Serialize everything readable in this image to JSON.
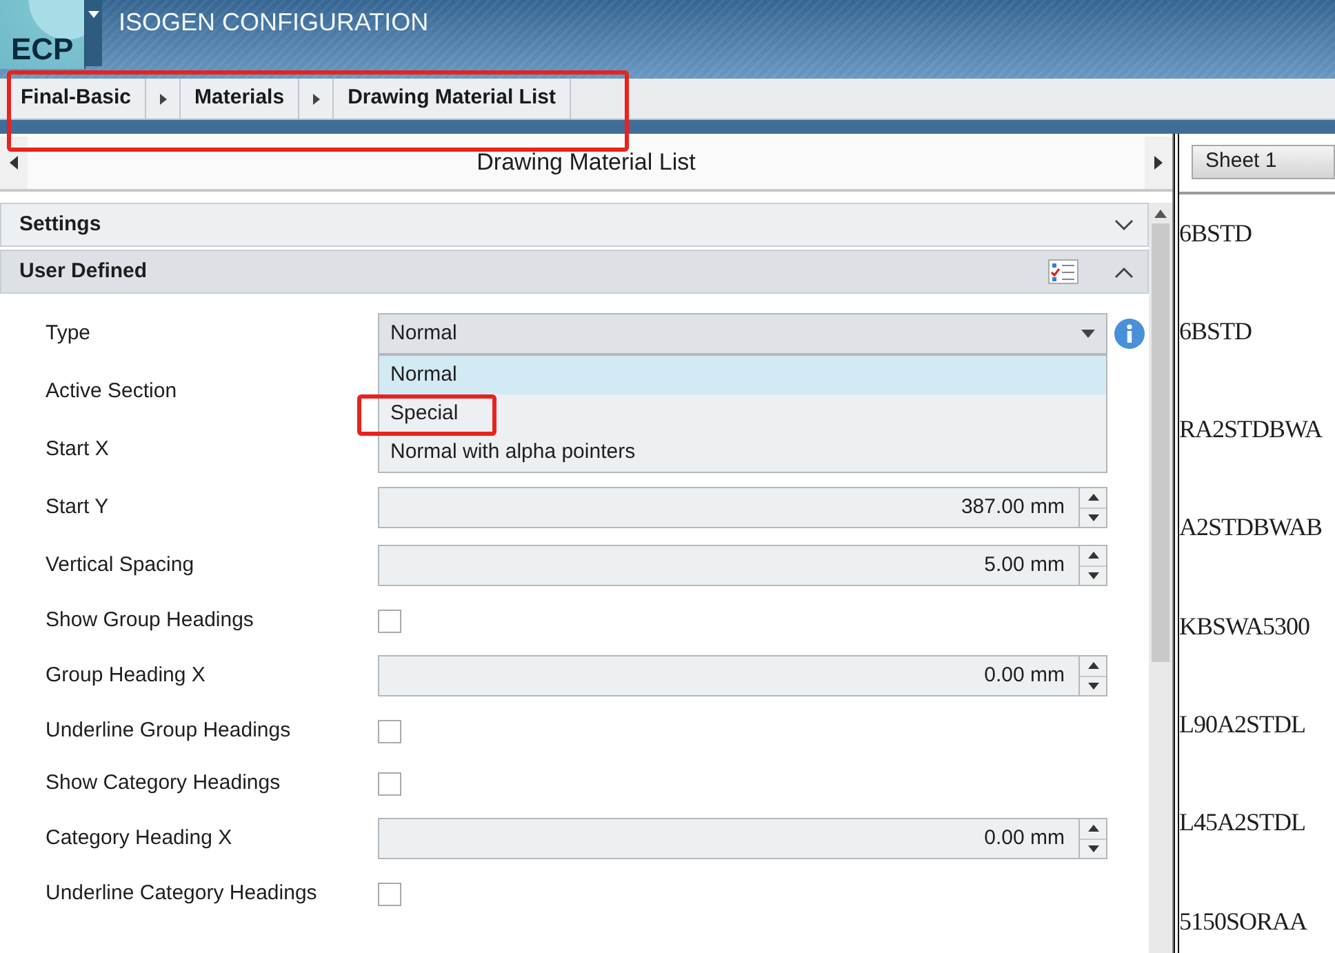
{
  "window": {
    "title": "ISOGEN CONFIGURATION",
    "logo": "ECP"
  },
  "breadcrumb": {
    "highlighted": true,
    "items": [
      "Final-Basic",
      "Materials",
      "Drawing Material List"
    ]
  },
  "panel": {
    "title": "Drawing Material List",
    "sections": [
      {
        "title": "Settings",
        "expanded": false
      },
      {
        "title": "User Defined",
        "expanded": true
      }
    ],
    "form": [
      {
        "kind": "dropdown",
        "label": "Type",
        "value": "Normal",
        "options": [
          {
            "label": "Normal",
            "selected": true,
            "highlighted": false
          },
          {
            "label": "Special",
            "selected": false,
            "highlighted": true
          },
          {
            "label": "Normal with alpha pointers",
            "selected": false,
            "highlighted": false
          }
        ]
      },
      {
        "kind": "covered",
        "label": "Active Section"
      },
      {
        "kind": "covered",
        "label": "Start X"
      },
      {
        "kind": "spin",
        "label": "Start Y",
        "value": "387.00 mm"
      },
      {
        "kind": "spin",
        "label": "Vertical Spacing",
        "value": "5.00 mm"
      },
      {
        "kind": "checkbox",
        "label": "Show Group Headings",
        "checked": false
      },
      {
        "kind": "spin",
        "label": "Group Heading X",
        "value": "0.00 mm"
      },
      {
        "kind": "checkbox",
        "label": "Underline Group Headings",
        "checked": false
      },
      {
        "kind": "checkbox",
        "label": "Show Category Headings",
        "checked": false
      },
      {
        "kind": "spin",
        "label": "Category Heading X",
        "value": "0.00 mm"
      },
      {
        "kind": "checkbox",
        "label": "Underline Category Headings",
        "checked": false
      }
    ]
  },
  "sheet": {
    "selector": "Sheet 1",
    "lines": [
      "6BSTD",
      "6BSTD",
      "RA2STDBWA",
      "A2STDBWAB",
      "KBSWA5300",
      "L90A2STDL",
      "L45A2STDL",
      "5150SORAA"
    ]
  }
}
